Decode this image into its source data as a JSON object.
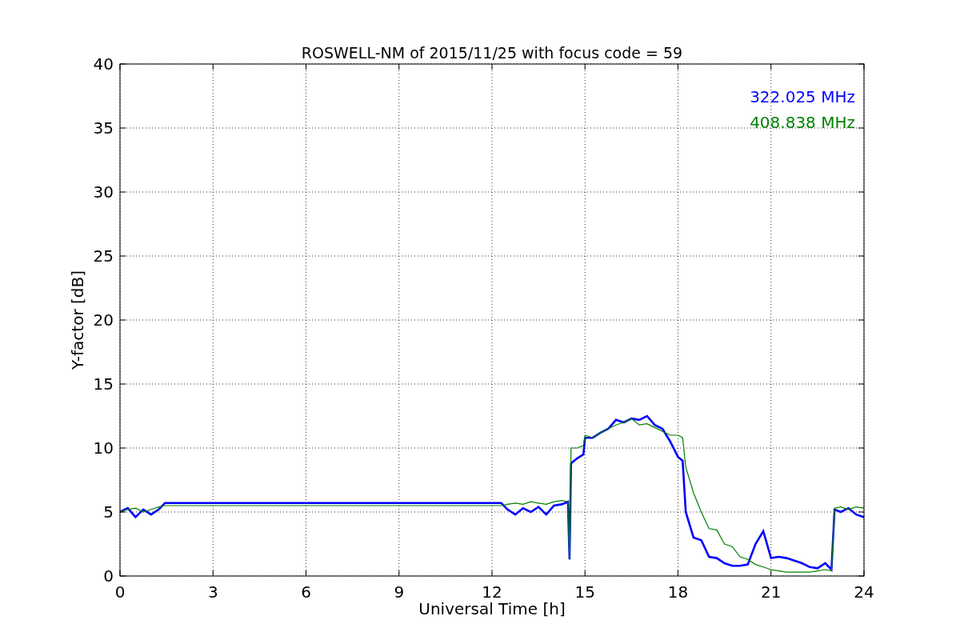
{
  "chart_data": {
    "type": "line",
    "title": "ROSWELL-NM of 2015/11/25 with focus code = 59",
    "xlabel": "Universal Time [h]",
    "ylabel": "Y-factor [dB]",
    "x": [
      0,
      0.25,
      0.5,
      0.75,
      1,
      1.25,
      1.45,
      12.3,
      12.5,
      12.75,
      13,
      13.25,
      13.5,
      13.75,
      14,
      14.25,
      14.45,
      14.5,
      14.55,
      14.75,
      14.95,
      15,
      15.25,
      15.5,
      15.75,
      16,
      16.25,
      16.5,
      16.75,
      17,
      17.25,
      17.5,
      17.75,
      18,
      18.15,
      18.25,
      18.5,
      18.75,
      19,
      19.25,
      19.5,
      19.75,
      20,
      20.25,
      20.5,
      20.75,
      21,
      21.25,
      21.5,
      21.75,
      22,
      22.25,
      22.5,
      22.75,
      22.95,
      23.05,
      23.25,
      23.5,
      23.75,
      24
    ],
    "series": [
      {
        "name": "322.025 MHz",
        "color": "#0000ff",
        "values": [
          5.0,
          5.3,
          4.6,
          5.2,
          4.8,
          5.2,
          5.7,
          5.7,
          5.2,
          4.8,
          5.3,
          5.0,
          5.4,
          4.8,
          5.5,
          5.6,
          5.8,
          1.3,
          8.8,
          9.2,
          9.5,
          10.8,
          10.8,
          11.2,
          11.5,
          12.2,
          12.0,
          12.3,
          12.2,
          12.5,
          11.8,
          11.5,
          10.5,
          9.3,
          9.0,
          5.0,
          3.0,
          2.8,
          1.5,
          1.4,
          1.0,
          0.8,
          0.8,
          0.9,
          2.5,
          3.5,
          1.4,
          1.5,
          1.4,
          1.2,
          1.0,
          0.7,
          0.6,
          1.0,
          0.5,
          5.2,
          5.0,
          5.3,
          4.8,
          4.6
        ]
      },
      {
        "name": "408.838 MHz",
        "color": "#008000",
        "values": [
          5.0,
          5.2,
          5.3,
          5.0,
          5.2,
          5.4,
          5.5,
          5.5,
          5.6,
          5.7,
          5.6,
          5.8,
          5.7,
          5.6,
          5.8,
          5.9,
          5.8,
          1.3,
          10.0,
          10.0,
          10.2,
          11.0,
          10.8,
          11.2,
          11.5,
          11.8,
          12.0,
          12.3,
          11.8,
          11.9,
          11.6,
          11.3,
          11.0,
          11.0,
          10.8,
          8.5,
          6.5,
          5.0,
          3.7,
          3.6,
          2.5,
          2.3,
          1.5,
          1.3,
          0.9,
          0.7,
          0.5,
          0.4,
          0.3,
          0.3,
          0.3,
          0.3,
          0.4,
          0.5,
          0.4,
          5.3,
          5.4,
          5.2,
          5.4,
          5.3
        ]
      }
    ],
    "xlim": [
      0,
      24
    ],
    "ylim": [
      0,
      40
    ],
    "xticks": [
      0,
      3,
      6,
      9,
      12,
      15,
      18,
      21,
      24
    ],
    "yticks": [
      0,
      5,
      10,
      15,
      20,
      25,
      30,
      35,
      40
    ],
    "grid": true
  }
}
